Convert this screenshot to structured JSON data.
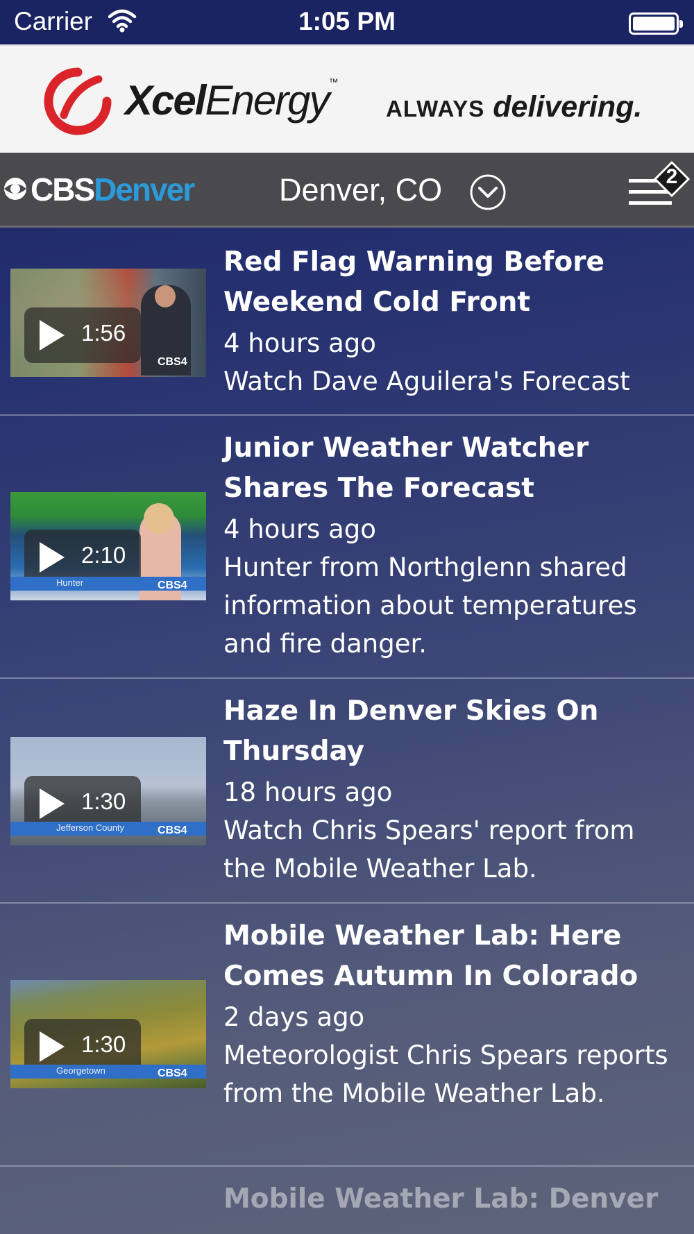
{
  "status_bar": {
    "carrier": "Carrier",
    "time": "1:05 PM"
  },
  "ad": {
    "brand_bold": "Xcel",
    "brand_light": "Energy",
    "tagline_always": "ALWAYS",
    "tagline_delivering": "delivering."
  },
  "header": {
    "logo_cbs": "CBS",
    "logo_city": "Denver",
    "location": "Denver, CO",
    "notification_count": "2",
    "colors": {
      "cbs_blue": "#2c9ad9",
      "nav_bg": "#4a4a4e"
    }
  },
  "videos": [
    {
      "title": "Red Flag Warning Before Weekend Cold Front",
      "time": "4 hours ago",
      "description": "Watch Dave Aguilera's Forecast",
      "duration": "1:56"
    },
    {
      "title": "Junior Weather Watcher Shares The Forecast",
      "time": "4 hours ago",
      "description": "Hunter from Northglenn shared information about temperatures and fire danger.",
      "duration": "2:10",
      "lower_third": "Hunter"
    },
    {
      "title": "Haze In Denver Skies On Thursday",
      "time": "18 hours ago",
      "description": "Watch Chris Spears' report from the Mobile Weather Lab.",
      "duration": "1:30",
      "lower_third": "Jefferson County"
    },
    {
      "title": "Mobile Weather Lab: Here Comes Autumn In Colorado",
      "time": "2 days ago",
      "description": "Meteorologist Chris Spears reports from the Mobile Weather Lab.",
      "duration": "1:30",
      "lower_third": "Georgetown"
    },
    {
      "title": "Mobile Weather Lab: Denver"
    }
  ]
}
